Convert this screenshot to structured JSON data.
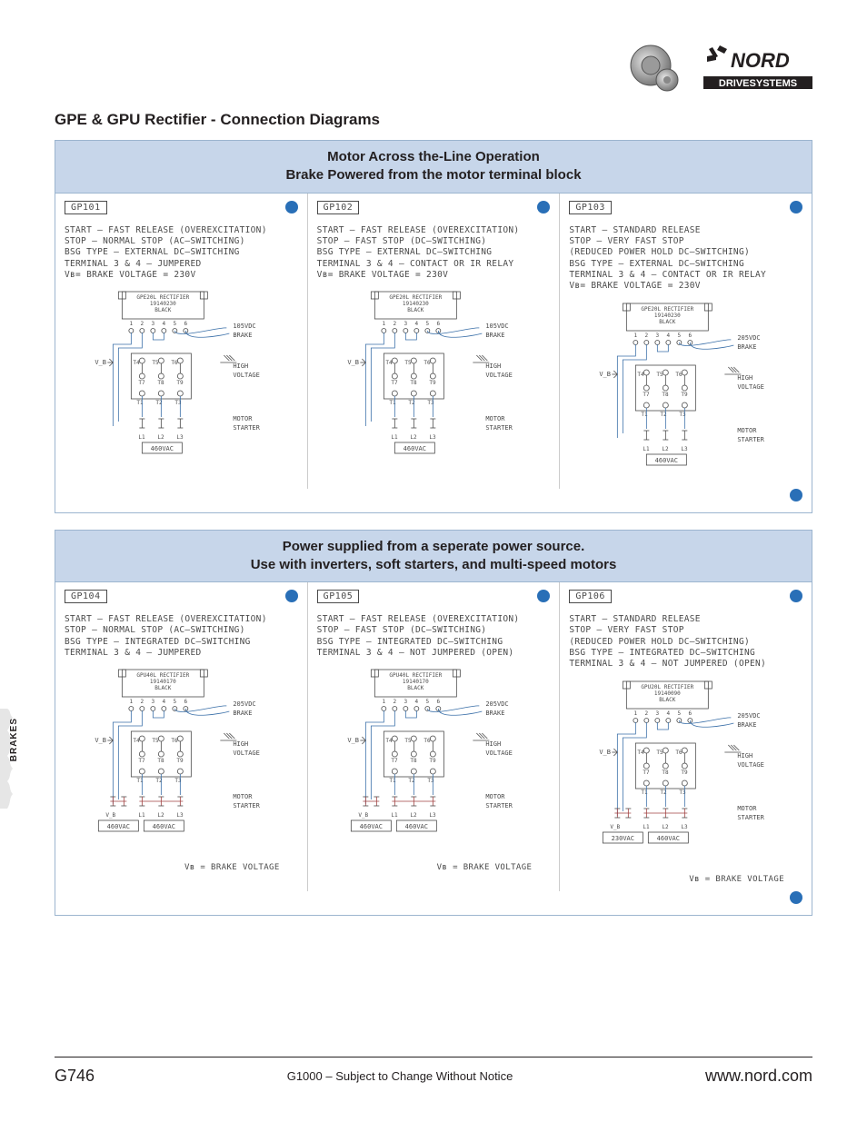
{
  "header": {
    "brand_top": "NORD",
    "brand_bottom": "DRIVESYSTEMS"
  },
  "title": "GPE & GPU Rectifier - Connection Diagrams",
  "side_tab": "BRAKES",
  "panel1": {
    "heading_line1": "Motor Across the-Line Operation",
    "heading_line2": "Brake Powered from the motor terminal block",
    "cells": [
      {
        "id": "GP101",
        "lines": [
          "START — FAST RELEASE (OVEREXCITATION)",
          "STOP — NORMAL STOP (AC–SWITCHING)",
          "BSG TYPE — EXTERNAL DC–SWITCHING",
          "TERMINAL 3 & 4 – JUMPERED",
          "V_B= BRAKE VOLTAGE = 230V"
        ],
        "rectifier_top": "GPE20L RECTIFIER",
        "rectifier_num": "19140230",
        "rectifier_color": "BLACK",
        "brake_v": "105VDC",
        "brake_label": "BRAKE",
        "vb": "V_B",
        "high_voltage": "HIGH\nVOLTAGE",
        "motor_starter": "MOTOR\nSTARTER",
        "supply": "460VAC",
        "t_upper": [
          "T4",
          "T5",
          "T6"
        ],
        "t_mid": [
          "T7",
          "T8",
          "T9"
        ],
        "t_lower": [
          "T1",
          "T2",
          "T3"
        ],
        "l": [
          "L1",
          "L2",
          "L3"
        ]
      },
      {
        "id": "GP102",
        "lines": [
          "START — FAST RELEASE (OVEREXCITATION)",
          "STOP — FAST STOP (DC–SWITCHING)",
          "BSG TYPE — EXTERNAL DC–SWITCHING",
          "TERMINAL 3 & 4 – CONTACT OR IR RELAY",
          "V_B= BRAKE VOLTAGE = 230V"
        ],
        "rectifier_top": "GPE20L RECTIFIER",
        "rectifier_num": "19140230",
        "rectifier_color": "BLACK",
        "brake_v": "105VDC",
        "brake_label": "BRAKE",
        "vb": "V_B",
        "high_voltage": "HIGH\nVOLTAGE",
        "motor_starter": "MOTOR\nSTARTER",
        "supply": "460VAC",
        "t_upper": [
          "T4",
          "T5",
          "T6"
        ],
        "t_mid": [
          "T7",
          "T8",
          "T9"
        ],
        "t_lower": [
          "T1",
          "T2",
          "T3"
        ],
        "l": [
          "L1",
          "L2",
          "L3"
        ]
      },
      {
        "id": "GP103",
        "lines": [
          "START — STANDARD RELEASE",
          "STOP — VERY FAST STOP",
          "(REDUCED POWER HOLD DC–SWITCHING)",
          "BSG TYPE — EXTERNAL DC–SWITCHING",
          "TERMINAL 3 & 4 – CONTACT OR IR RELAY",
          "V_B= BRAKE VOLTAGE = 230V"
        ],
        "rectifier_top": "GPE20L RECTIFIER",
        "rectifier_num": "19140230",
        "rectifier_color": "BLACK",
        "brake_v": "205VDC",
        "brake_label": "BRAKE",
        "vb": "V_B",
        "high_voltage": "HIGH\nVOLTAGE",
        "motor_starter": "MOTOR\nSTARTER",
        "supply": "460VAC",
        "t_upper": [
          "T4",
          "T5",
          "T6"
        ],
        "t_mid": [
          "T7",
          "T8",
          "T9"
        ],
        "t_lower": [
          "T1",
          "T2",
          "T3"
        ],
        "l": [
          "L1",
          "L2",
          "L3"
        ]
      }
    ]
  },
  "panel2": {
    "heading_line1": "Power supplied from a seperate power source.",
    "heading_line2": "Use with inverters, soft starters, and multi-speed motors",
    "foot_note": "V_B = BRAKE VOLTAGE",
    "cells": [
      {
        "id": "GP104",
        "lines": [
          "START — FAST RELEASE (OVEREXCITATION)",
          "STOP — NORMAL STOP (AC–SWITCHING)",
          "BSG TYPE — INTEGRATED DC–SWITCHING",
          "TERMINAL 3 & 4 – JUMPERED"
        ],
        "rectifier_top": "GPU40L RECTIFIER",
        "rectifier_num": "19140170",
        "rectifier_color": "BLACK",
        "brake_v": "205VDC",
        "brake_label": "BRAKE",
        "vb": "V_B",
        "high_voltage": "HIGH\nVOLTAGE",
        "motor_starter": "MOTOR\nSTARTER",
        "supply_left": "460VAC",
        "supply_right": "460VAC",
        "t_upper": [
          "T4",
          "T5",
          "T6"
        ],
        "t_mid": [
          "T7",
          "T8",
          "T9"
        ],
        "t_lower": [
          "T1",
          "T2",
          "T3"
        ],
        "l": [
          "L1",
          "L2",
          "L3"
        ]
      },
      {
        "id": "GP105",
        "lines": [
          "START — FAST RELEASE (OVEREXCITATION)",
          "STOP — FAST STOP (DC–SWITCHING)",
          "BSG TYPE — INTEGRATED DC–SWITCHING",
          "TERMINAL 3 & 4 – NOT JUMPERED (OPEN)"
        ],
        "rectifier_top": "GPU40L RECTIFIER",
        "rectifier_num": "19140170",
        "rectifier_color": "BLACK",
        "brake_v": "205VDC",
        "brake_label": "BRAKE",
        "vb": "V_B",
        "high_voltage": "HIGH\nVOLTAGE",
        "motor_starter": "MOTOR\nSTARTER",
        "supply_left": "460VAC",
        "supply_right": "460VAC",
        "t_upper": [
          "T4",
          "T5",
          "T6"
        ],
        "t_mid": [
          "T7",
          "T8",
          "T9"
        ],
        "t_lower": [
          "T1",
          "T2",
          "T3"
        ],
        "l": [
          "L1",
          "L2",
          "L3"
        ]
      },
      {
        "id": "GP106",
        "lines": [
          "START — STANDARD RELEASE",
          "STOP — VERY FAST STOP",
          "(REDUCED POWER HOLD DC–SWITCHING)",
          "BSG TYPE — INTEGRATED DC–SWITCHING",
          "TERMINAL 3 & 4 – NOT JUMPERED (OPEN)"
        ],
        "rectifier_top": "GPU20L RECTIFIER",
        "rectifier_num": "19140090",
        "rectifier_color": "BLACK",
        "brake_v": "205VDC",
        "brake_label": "BRAKE",
        "vb": "V_B",
        "high_voltage": "HIGH\nVOLTAGE",
        "motor_starter": "MOTOR\nSTARTER",
        "supply_left": "230VAC",
        "supply_right": "460VAC",
        "t_upper": [
          "T4",
          "T5",
          "T6"
        ],
        "t_mid": [
          "T7",
          "T8",
          "T9"
        ],
        "t_lower": [
          "T1",
          "T2",
          "T3"
        ],
        "l": [
          "L1",
          "L2",
          "L3"
        ]
      }
    ]
  },
  "footer": {
    "page": "G746",
    "middle": "G1000 – Subject to Change Without Notice",
    "url": "www.nord.com"
  }
}
